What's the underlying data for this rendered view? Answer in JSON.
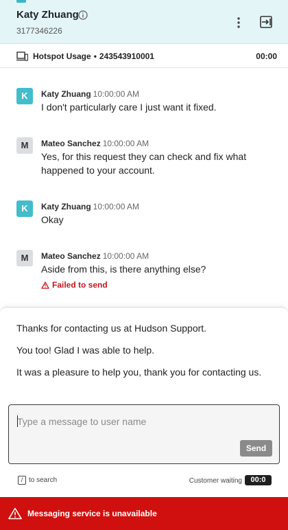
{
  "header": {
    "customer_name": "Katy Zhuang",
    "customer_phone": "3177346226"
  },
  "subheader": {
    "title": "Hotspot Usage",
    "separator": "•",
    "account_number": "243543910001",
    "timer": "00:00"
  },
  "messages": [
    {
      "avatar": "K",
      "author": "Katy Zhuang",
      "time": "10:00:00 AM",
      "text": "I don't particularly care I just want it fixed."
    },
    {
      "avatar": "M",
      "author": "Mateo Sanchez",
      "time": "10:00:00 AM",
      "text": "Yes, for this request they can check and fix what happened to your account."
    },
    {
      "avatar": "K",
      "author": "Katy Zhuang",
      "time": "10:00:00 AM",
      "text": "Okay"
    },
    {
      "avatar": "M",
      "author": "Mateo Sanchez",
      "time": "10:00:00 AM",
      "text": "Aside from this, is there anything else?",
      "status": "Failed to send"
    }
  ],
  "canned_responses": [
    "Thanks for contacting us at Hudson Support.",
    "You too! Glad I was able to help.",
    "It was a pleasure to help you, thank you for contacting us."
  ],
  "composer": {
    "placeholder": "Type a message to user name",
    "send_label": "Send"
  },
  "footer": {
    "search_key": "/",
    "search_hint": "to search",
    "waiting_label": "Customer waiting",
    "waiting_time": "00:0"
  },
  "error_banner": {
    "text": "Messaging service is unavailable"
  },
  "colors": {
    "header_bg": "#e4f5f7",
    "avatar_customer": "#43bccc",
    "avatar_agent": "#dcdde0",
    "error_red": "#d0100f",
    "failed_text": "#c0191e"
  }
}
